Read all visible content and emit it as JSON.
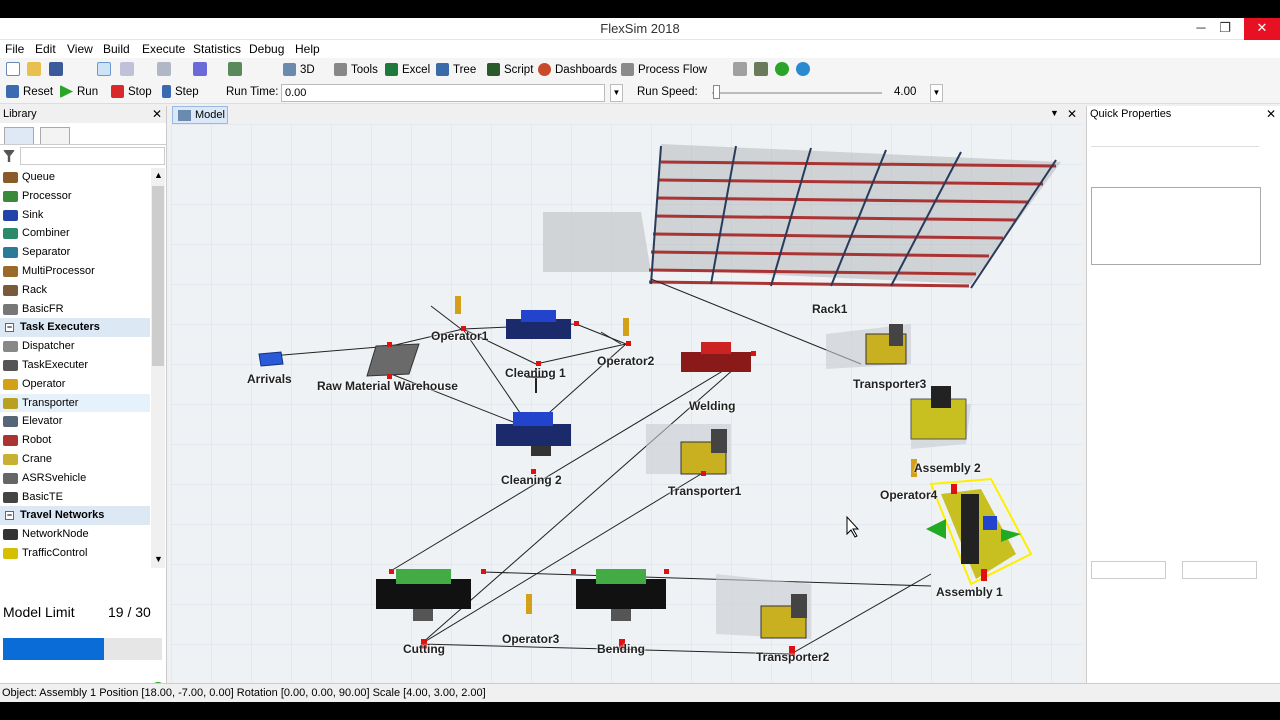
{
  "window": {
    "title": "FlexSim 2018",
    "minimize": "─",
    "restore": "❐",
    "close": "✕"
  },
  "menu": [
    "File",
    "Edit",
    "View",
    "Build",
    "Execute",
    "Statistics",
    "Debug",
    "Help"
  ],
  "toolbar": {
    "view_3d": "3D",
    "tools": "Tools",
    "excel": "Excel",
    "tree": "Tree",
    "script": "Script",
    "dashboards": "Dashboards",
    "process_flow": "Process Flow"
  },
  "run_controls": {
    "reset": "Reset",
    "run": "Run",
    "stop": "Stop",
    "step": "Step",
    "run_time_label": "Run Time:",
    "run_time_value": "0.00",
    "run_speed_label": "Run Speed:",
    "run_speed_value": "4.00"
  },
  "library": {
    "title": "Library",
    "items": [
      {
        "label": "Queue",
        "type": "item",
        "color": "#8b5a2b"
      },
      {
        "label": "Processor",
        "type": "item",
        "color": "#3a8a3a"
      },
      {
        "label": "Sink",
        "type": "item",
        "color": "#2244aa"
      },
      {
        "label": "Combiner",
        "type": "item",
        "color": "#2a8a6a"
      },
      {
        "label": "Separator",
        "type": "item",
        "color": "#2a7a9a"
      },
      {
        "label": "MultiProcessor",
        "type": "item",
        "color": "#9a6a2a"
      },
      {
        "label": "Rack",
        "type": "item",
        "color": "#7a5a3a"
      },
      {
        "label": "BasicFR",
        "type": "item",
        "color": "#777777"
      },
      {
        "label": "Task Executers",
        "type": "category"
      },
      {
        "label": "Dispatcher",
        "type": "item",
        "color": "#888888"
      },
      {
        "label": "TaskExecuter",
        "type": "item",
        "color": "#555555"
      },
      {
        "label": "Operator",
        "type": "item",
        "color": "#d4a017"
      },
      {
        "label": "Transporter",
        "type": "item",
        "color": "#b8a020",
        "selected": true
      },
      {
        "label": "Elevator",
        "type": "item",
        "color": "#556677"
      },
      {
        "label": "Robot",
        "type": "item",
        "color": "#aa3333"
      },
      {
        "label": "Crane",
        "type": "item",
        "color": "#c8b030"
      },
      {
        "label": "ASRSvehicle",
        "type": "item",
        "color": "#666666"
      },
      {
        "label": "BasicTE",
        "type": "item",
        "color": "#444444"
      },
      {
        "label": "Travel Networks",
        "type": "category"
      },
      {
        "label": "NetworkNode",
        "type": "item",
        "color": "#333333"
      },
      {
        "label": "TrafficControl",
        "type": "item",
        "color": "#d4c000"
      }
    ],
    "model_limit_label": "Model Limit",
    "model_limit_value": "19 / 30",
    "model_limit_fraction": 0.633
  },
  "model": {
    "tab_label": "Model",
    "objects": {
      "rack1": "Rack1",
      "arrivals": "Arrivals",
      "raw_material_warehouse": "Raw Material Warehouse",
      "operator1": "Operator1",
      "cleaning1": "Cleaning 1",
      "operator2": "Operator2",
      "welding": "Welding",
      "transporter3": "Transporter3",
      "cleaning2": "Cleaning 2",
      "transporter1": "Transporter1",
      "assembly2": "Assembly 2",
      "operator4": "Operator4",
      "assembly1": "Assembly 1",
      "cutting": "Cutting",
      "operator3": "Operator3",
      "bending": "Bending",
      "transporter2": "Transporter2"
    }
  },
  "quick_properties": {
    "title": "Quick Properties"
  },
  "status": "Object: Assembly 1 Position [18.00, -7.00, 0.00]  Rotation [0.00, 0.00, 90.00]  Scale [4.00, 3.00, 2.00]"
}
